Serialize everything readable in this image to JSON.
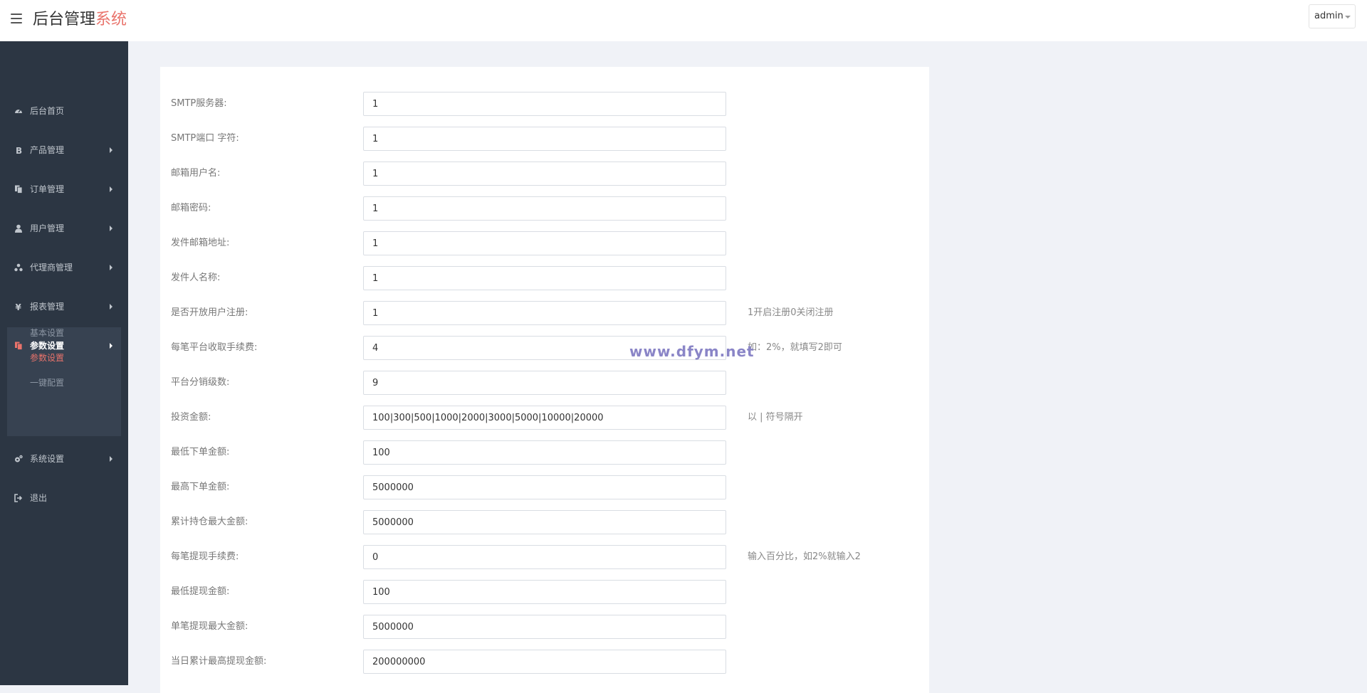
{
  "header": {
    "brand_main": "后台管理",
    "brand_accent": "系统",
    "user": "admin"
  },
  "sidebar": {
    "items": [
      {
        "label": "后台首页",
        "icon": "dashboard-icon"
      },
      {
        "label": "产品管理",
        "icon": "bitcoin-icon"
      },
      {
        "label": "订单管理",
        "icon": "copy-icon"
      },
      {
        "label": "用户管理",
        "icon": "user-icon"
      },
      {
        "label": "代理商管理",
        "icon": "sitemap-icon"
      },
      {
        "label": "报表管理",
        "icon": "yen-icon"
      },
      {
        "label": "参数设置",
        "icon": "files-icon"
      },
      {
        "label": "系统设置",
        "icon": "gears-icon"
      },
      {
        "label": "退出",
        "icon": "sign-out-icon"
      }
    ],
    "sub_items": [
      "基本设置",
      "参数设置",
      "一键配置"
    ]
  },
  "form": {
    "fields": [
      {
        "label": "SMTP服务器:",
        "value": "1"
      },
      {
        "label": "SMTP端口 字符:",
        "value": "1"
      },
      {
        "label": "邮箱用户名:",
        "value": "1"
      },
      {
        "label": "邮箱密码:",
        "value": "1"
      },
      {
        "label": "发件邮箱地址:",
        "value": "1"
      },
      {
        "label": "发件人名称:",
        "value": "1"
      },
      {
        "label": "是否开放用户注册:",
        "value": "1",
        "hint": "1开启注册0关闭注册"
      },
      {
        "label": "每笔平台收取手续费:",
        "value": "4",
        "hint": "如：2%，就填写2即可"
      },
      {
        "label": "平台分销级数:",
        "value": "9"
      },
      {
        "label": "投资金额:",
        "value": "100|300|500|1000|2000|3000|5000|10000|20000",
        "hint": "以 | 符号隔开"
      },
      {
        "label": "最低下单金额:",
        "value": "100"
      },
      {
        "label": "最高下单金额:",
        "value": "5000000"
      },
      {
        "label": "累计持仓最大金额:",
        "value": "5000000"
      },
      {
        "label": "每笔提现手续费:",
        "value": "0",
        "hint": "输入百分比，如2%就输入2"
      },
      {
        "label": "最低提现金额:",
        "value": "100"
      },
      {
        "label": "单笔提现最大金额:",
        "value": "5000000"
      },
      {
        "label": "当日累计最高提现金额:",
        "value": "200000000"
      }
    ]
  },
  "watermark": "www.dfym.net",
  "colors": {
    "sidebar_bg": "#2c3643",
    "accent": "#e9736b",
    "page_bg": "#f0f2f7"
  }
}
